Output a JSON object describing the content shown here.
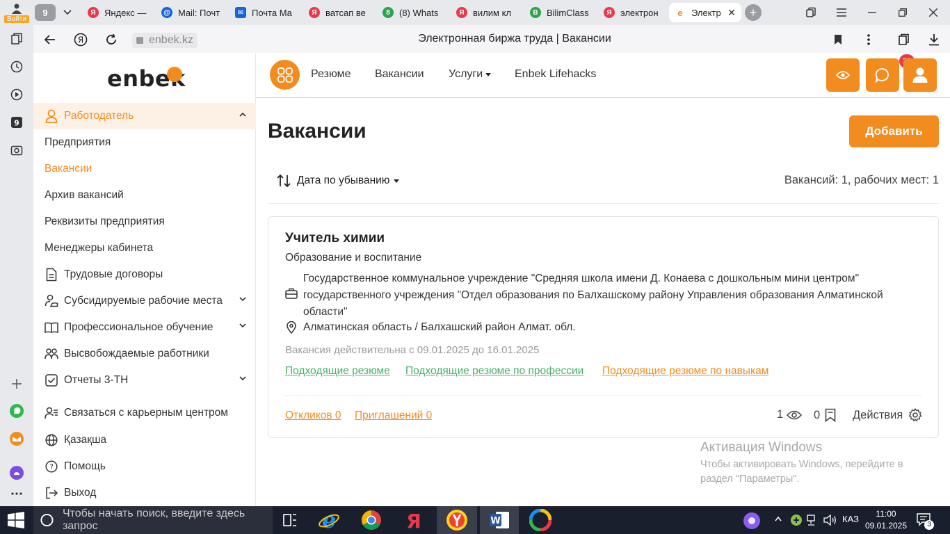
{
  "browser": {
    "login_label": "Войти",
    "tab_count": "9",
    "tabs": [
      {
        "title": "Яндекс —",
        "favicon": "yandex-icon",
        "color": "#e8394a"
      },
      {
        "title": "Mail: Почт",
        "favicon": "mail-at-icon",
        "color": "#1565d8"
      },
      {
        "title": "Почта Ма",
        "favicon": "mail-envelope-icon",
        "color": "#1565d8"
      },
      {
        "title": "ватсап ве",
        "favicon": "yandex-icon",
        "color": "#e8394a"
      },
      {
        "title": "(8) Whats",
        "favicon": "whatsapp-icon",
        "color": "#2ca24f"
      },
      {
        "title": "вилим кл",
        "favicon": "yandex-icon",
        "color": "#e8394a"
      },
      {
        "title": "BilimClass",
        "favicon": "bilimclass-icon",
        "color": "#2ca24f"
      },
      {
        "title": "электрон",
        "favicon": "yandex-icon",
        "color": "#e8394a"
      },
      {
        "title": "Электр",
        "favicon": "enbek-icon",
        "color": "#f28c1e"
      }
    ],
    "url_domain": "enbek.kz",
    "page_title": "Электронная биржа труда | Вакансии"
  },
  "sidebar": {
    "logo": "enbek",
    "items": [
      {
        "label": "Работодатель",
        "icon": "user-icon"
      },
      {
        "label": "Предприятия"
      },
      {
        "label": "Вакансии"
      },
      {
        "label": "Архив вакансий"
      },
      {
        "label": "Реквизиты предприятия"
      },
      {
        "label": "Менеджеры кабинета"
      },
      {
        "label": "Трудовые договоры",
        "icon": "document-icon"
      },
      {
        "label": "Субсидируемые рабочие места",
        "icon": "user-hand-icon"
      },
      {
        "label": "Профессиональное обучение",
        "icon": "book-icon"
      },
      {
        "label": "Высвобождаемые работники",
        "icon": "users-icon"
      },
      {
        "label": "Отчеты 3-ТН",
        "icon": "checkbox-icon"
      },
      {
        "label": "Связаться с карьерным центром",
        "icon": "contact-icon"
      },
      {
        "label": "Қазақша",
        "icon": "globe-icon"
      },
      {
        "label": "Помощь",
        "icon": "help-icon"
      },
      {
        "label": "Выход",
        "icon": "logout-icon"
      }
    ]
  },
  "header": {
    "nav": [
      "Резюме",
      "Вакансии",
      "Услуги",
      "Enbek Lifehacks"
    ],
    "chat_badge": "22"
  },
  "main": {
    "title": "Вакансии",
    "add_button": "Добавить",
    "sort_label": "Дата по убыванию",
    "count_text": "Вакансий: 1, рабочих мест: 1"
  },
  "vacancy": {
    "title": "Учитель химии",
    "category": "Образование и воспитание",
    "organization": "Государственное коммунальное учреждение \"Средняя школа имени Д. Конаева с дошкольным мини центром\" государственного учреждения \"Отдел образования по Балхашскому району Управления образования Алматинской области\"",
    "location": "Алматинская область / Балхашский район Алмат. обл.",
    "validity": "Вакансия действительна с 09.01.2025 до 16.01.2025",
    "links": [
      "Подходящие резюме",
      "Подходящие резюме по профессии",
      "Подходящие резюме по навыкам"
    ],
    "responses": "Откликов 0",
    "invitations": "Приглашений 0",
    "views": "1",
    "saved": "0",
    "actions": "Действия"
  },
  "watermark": {
    "line1": "Активация Windows",
    "line2": "Чтобы активировать Windows, перейдите в",
    "line3": "раздел \"Параметры\"."
  },
  "taskbar": {
    "search_placeholder": "Чтобы начать поиск, введите здесь запрос",
    "lang": "КАЗ",
    "time": "11:00",
    "date": "09.01.2025",
    "notifications": "3"
  },
  "colors": {
    "accent": "#f28c1e",
    "link_green": "#4caf6a",
    "badge_red": "#e8394a",
    "taskbar": "#1a1f2e"
  }
}
